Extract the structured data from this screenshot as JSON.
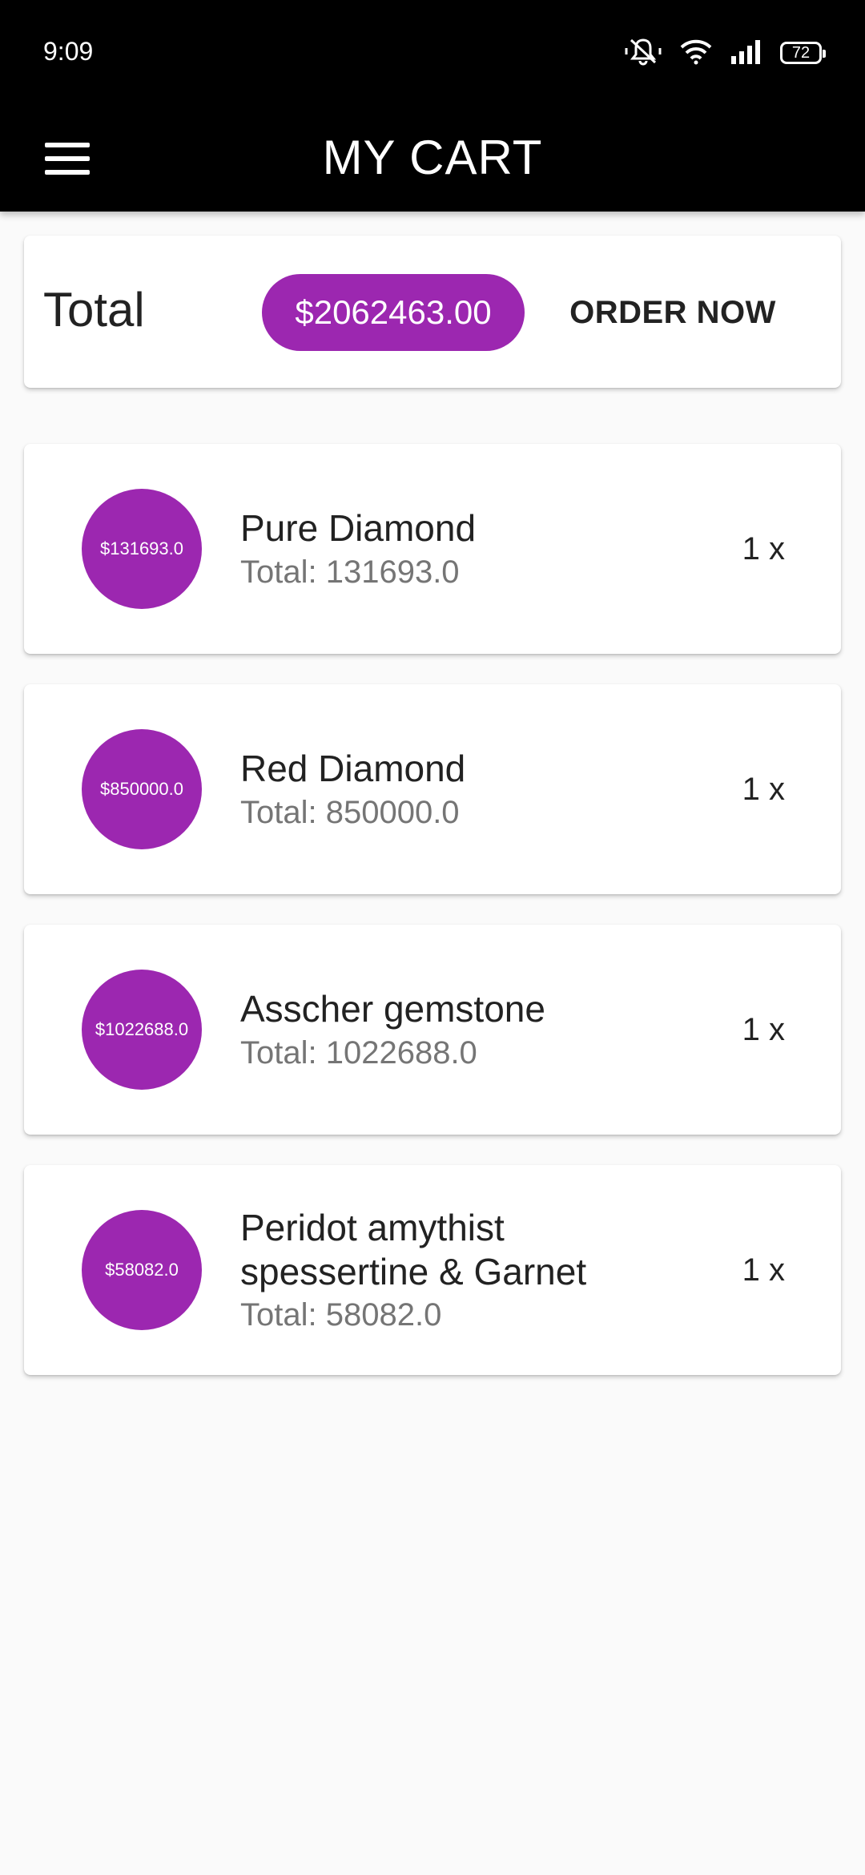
{
  "status_bar": {
    "time": "9:09",
    "battery": "72",
    "icons": [
      "mute-bell-icon",
      "wifi-icon",
      "signal-icon",
      "battery-icon"
    ]
  },
  "app_bar": {
    "title": "MY CART",
    "menu_icon": "hamburger-menu-icon"
  },
  "summary": {
    "total_label": "Total",
    "total_amount": "$2062463.00",
    "order_button": "ORDER NOW"
  },
  "items": [
    {
      "badge": "$131693.0",
      "name": "Pure Diamond",
      "total": "Total: 131693.0",
      "qty": "1 x"
    },
    {
      "badge": "$850000.0",
      "name": "Red Diamond",
      "total": "Total: 850000.0",
      "qty": "1 x"
    },
    {
      "badge": "$1022688.0",
      "name": "Asscher gemstone",
      "total": "Total: 1022688.0",
      "qty": "1 x"
    },
    {
      "badge": "$58082.0",
      "name": "Peridot amythist spessertine & Garnet",
      "total": "Total: 58082.0",
      "qty": "1 x"
    }
  ],
  "colors": {
    "accent": "#9c27b0",
    "app_bar": "#000000",
    "background": "#fafafa"
  }
}
